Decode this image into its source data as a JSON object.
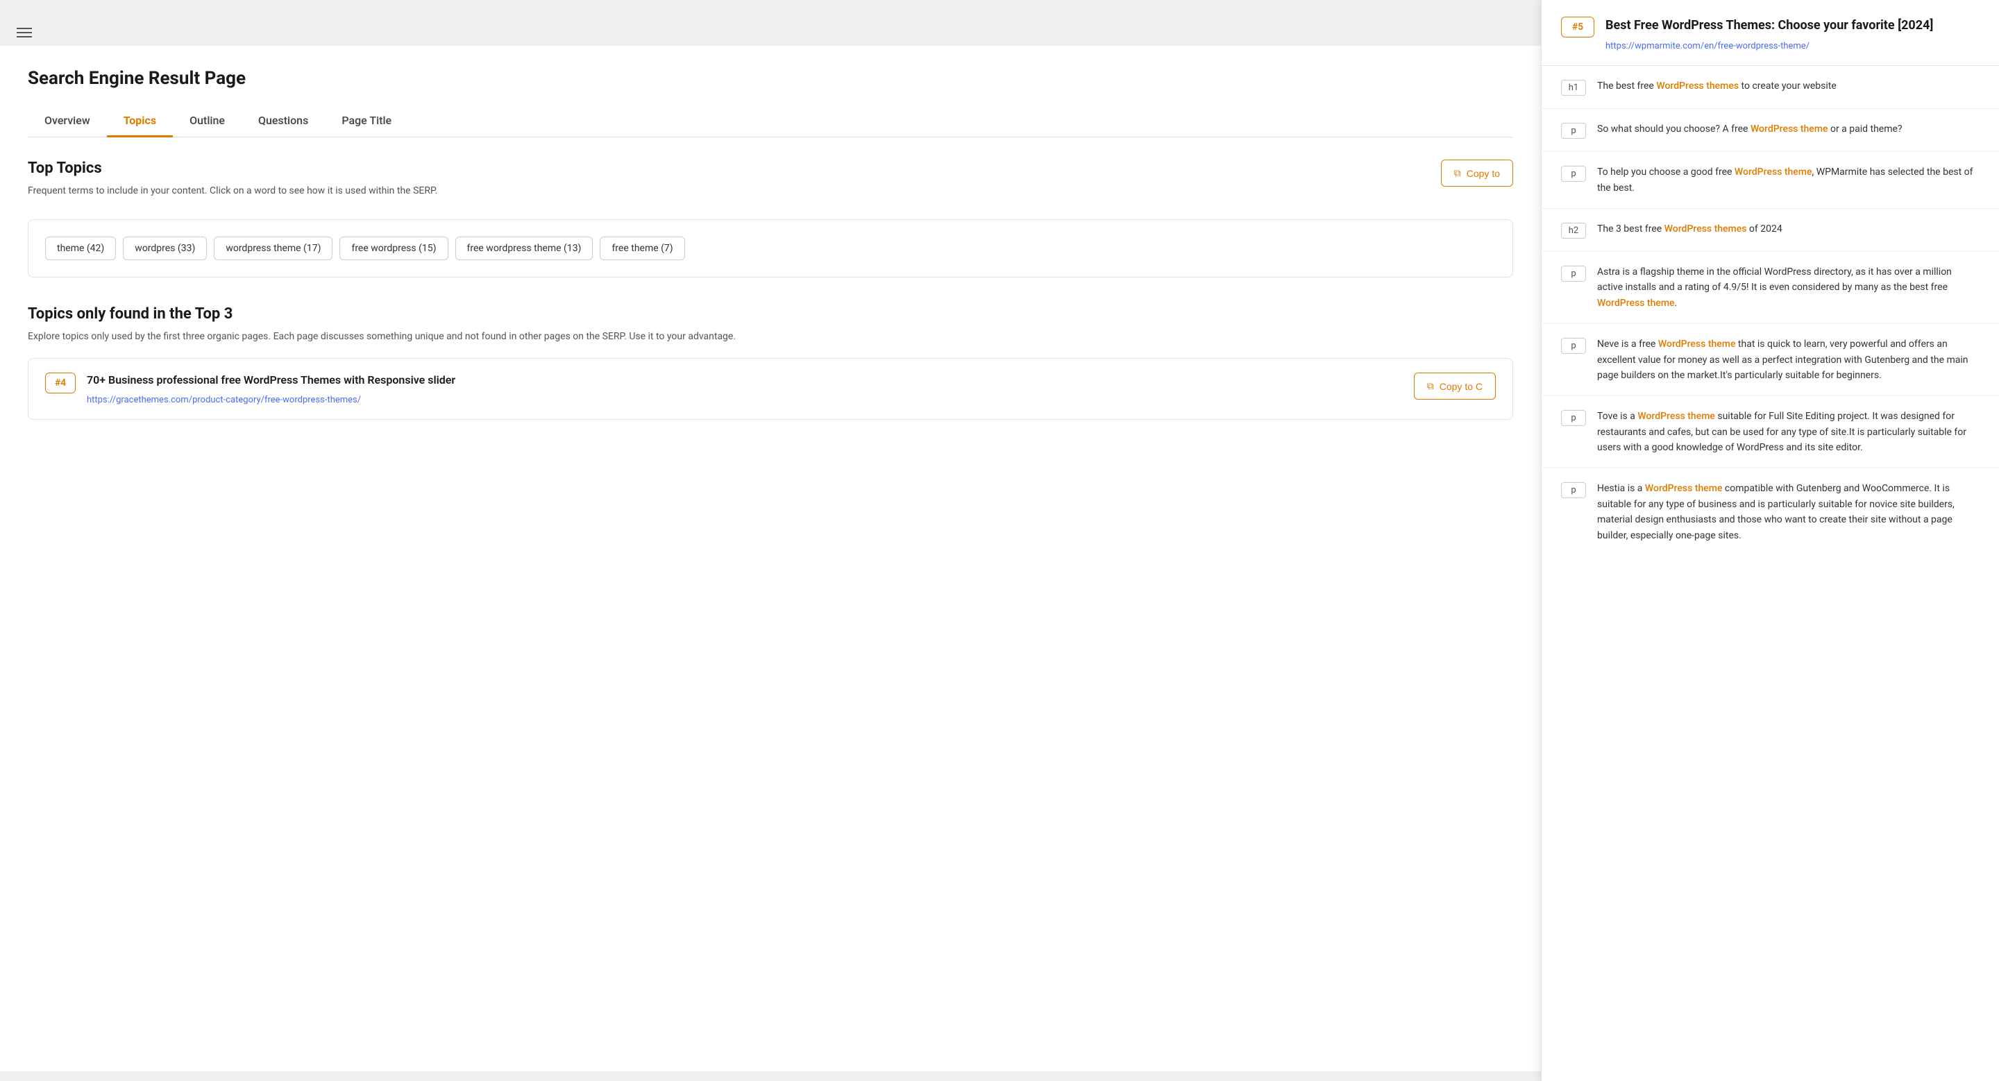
{
  "header": {
    "page_heading": "Search Engine Result Page"
  },
  "tabs": [
    {
      "id": "overview",
      "label": "Overview",
      "active": false
    },
    {
      "id": "topics",
      "label": "Topics",
      "active": true
    },
    {
      "id": "outline",
      "label": "Outline",
      "active": false
    },
    {
      "id": "questions",
      "label": "Questions",
      "active": false
    },
    {
      "id": "page_title",
      "label": "Page Title",
      "active": false
    }
  ],
  "top_topics": {
    "title": "Top Topics",
    "description": "Frequent terms to include in your content. Click on a word to see how it is used within the SERP.",
    "copy_btn": "Copy to",
    "tags": [
      "theme (42)",
      "wordpres (33)",
      "wordpress theme (17)",
      "free wordpress (15)",
      "free wordpress theme (13)",
      "free theme (7)"
    ]
  },
  "topics_only": {
    "title": "Topics only found in the Top 3",
    "description": "Explore topics only used by the first three organic pages. Each page discusses something unique and not found in other pages on the SERP. Use it to your advantage.",
    "result_card": {
      "rank": "#4",
      "title": "70+ Business professional free WordPress Themes with Responsive slider",
      "url": "https://gracethemes.com/product-category/free-wordpress-themes/",
      "copy_btn": "Copy to C"
    }
  },
  "right_panel": {
    "result": {
      "rank": "#5",
      "title": "Best Free WordPress Themes: Choose your favorite [2024]",
      "url": "https://wpmarmite.com/en/free-wordpress-theme/"
    },
    "content_items": [
      {
        "tag": "h1",
        "text_parts": [
          {
            "text": "The best free ",
            "highlight": false
          },
          {
            "text": "WordPress themes",
            "highlight": true
          },
          {
            "text": " to create your website",
            "highlight": false
          }
        ]
      },
      {
        "tag": "p",
        "text_parts": [
          {
            "text": "So what should you choose? A free ",
            "highlight": false
          },
          {
            "text": "WordPress theme",
            "highlight": true
          },
          {
            "text": " or a paid theme?",
            "highlight": false
          }
        ]
      },
      {
        "tag": "p",
        "text_parts": [
          {
            "text": "To help you choose a good free ",
            "highlight": false
          },
          {
            "text": "WordPress theme",
            "highlight": true
          },
          {
            "text": ", WPMarmite has selected the best of the best.",
            "highlight": false
          }
        ]
      },
      {
        "tag": "h2",
        "text_parts": [
          {
            "text": "The 3 best free ",
            "highlight": false
          },
          {
            "text": "WordPress themes",
            "highlight": true
          },
          {
            "text": " of 2024",
            "highlight": false
          }
        ]
      },
      {
        "tag": "p",
        "text_parts": [
          {
            "text": "Astra is a flagship theme in the official WordPress directory, as it has over a million active installs and a rating of 4.9/5! It is even considered by many as the best free ",
            "highlight": false
          },
          {
            "text": "WordPress theme",
            "highlight": true
          },
          {
            "text": ".",
            "highlight": false
          }
        ]
      },
      {
        "tag": "p",
        "text_parts": [
          {
            "text": "Neve is a free ",
            "highlight": false
          },
          {
            "text": "WordPress theme",
            "highlight": true
          },
          {
            "text": " that is quick to learn, very powerful and offers an excellent value for money as well as a perfect integration with Gutenberg and the main page builders on the market.It's particularly suitable for beginners.",
            "highlight": false
          }
        ]
      },
      {
        "tag": "p",
        "text_parts": [
          {
            "text": "Tove is a ",
            "highlight": false
          },
          {
            "text": "WordPress theme",
            "highlight": true
          },
          {
            "text": " suitable for Full Site Editing project. It was designed for restaurants and cafes, but can be used for any type of site.It is particularly suitable for users with a good knowledge of WordPress and its site editor.",
            "highlight": false
          }
        ]
      },
      {
        "tag": "p",
        "text_parts": [
          {
            "text": "Hestia is a ",
            "highlight": false
          },
          {
            "text": "WordPress theme",
            "highlight": true
          },
          {
            "text": " compatible with Gutenberg and WooCommerce. It is suitable for any type of business and is particularly suitable for novice site builders, material design enthusiasts and those who want to create their site without a page builder, especially one-page sites.",
            "highlight": false
          }
        ]
      }
    ]
  },
  "icons": {
    "menu": "☰",
    "copy": "⧉"
  }
}
